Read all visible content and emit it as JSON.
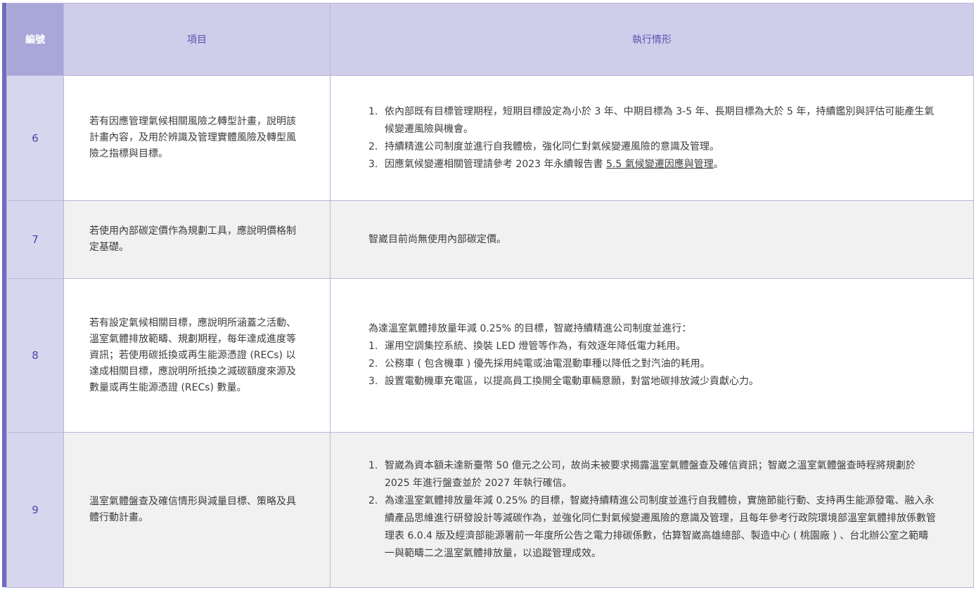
{
  "header": {
    "num": "編號",
    "item": "項目",
    "status": "執行情形"
  },
  "rows": [
    {
      "num": "6",
      "item": "若有因應管理氣候相關風險之轉型計畫，說明該計畫內容，及用於辨識及管理實體風險及轉型風險之指標與目標。",
      "detail": [
        "依內部既有目標管理期程，短期目標設定為小於 3 年、中期目標為 3-5 年、長期目標為大於 5 年，持續鑑別與評估可能產生氣候變遷風險與機會。",
        "持續精進公司制度並進行自我體檢，強化同仁對氣候變遷風險的意識及管理。",
        "因應氣候變遷相關管理請參考 2023 年永續報告書 "
      ],
      "detail_link": "5.5 氣候變遷因應與管理",
      "detail_link_suffix": "。"
    },
    {
      "num": "7",
      "item": "若使用內部碳定價作為規劃工具，應說明價格制定基礎。",
      "detail_text": "智崴目前尚無使用內部碳定價。"
    },
    {
      "num": "8",
      "item": "若有設定氣候相關目標，應說明所涵蓋之活動、溫室氣體排放範疇、規劃期程，每年達成進度等資訊；若使用碳抵換或再生能源憑證 (RECs) 以達成相關目標，應說明所抵換之減碳額度來源及數量或再生能源憑證 (RECs) 數量。",
      "intro": "為達溫室氣體排放量年減 0.25% 的目標，智崴持續精進公司制度並進行：",
      "detail": [
        "運用空調集控系統、換裝 LED 燈管等作為，有效逐年降低電力耗用。",
        "公務車 ( 包含機車 ) 優先採用純電或油電混動車種以降低之對汽油的耗用。",
        "設置電動機車充電區，以提高員工換開全電動車輛意願，對當地碳排放減少貢獻心力。"
      ]
    },
    {
      "num": "9",
      "item": "溫室氣體盤查及確信情形與減量目標、策略及具體行動計畫。",
      "detail": [
        "智崴為資本額未達新臺幣 50 億元之公司，故尚未被要求揭露溫室氣體盤查及確信資訊；智崴之溫室氣體盤查時程將規劃於 2025 年進行盤查並於 2027 年執行確信。",
        "為達溫室氣體排放量年減 0.25% 的目標，智崴持續精進公司制度並進行自我體檢，實施節能行動、支持再生能源發電、融入永續產品思維進行研發設計等減碳作為，並強化同仁對氣候變遷風險的意識及管理，且每年參考行政院環境部溫室氣體排放係數管理表 6.0.4 版及經濟部能源署前一年度所公告之電力排碳係數，估算智崴高雄總部、製造中心 ( 桃園廠 ) 、台北辦公室之範疇一與範疇二之溫室氣體排放量，以追蹤管理成效。"
      ]
    }
  ],
  "list_markers": [
    "1.",
    "2.",
    "3."
  ]
}
